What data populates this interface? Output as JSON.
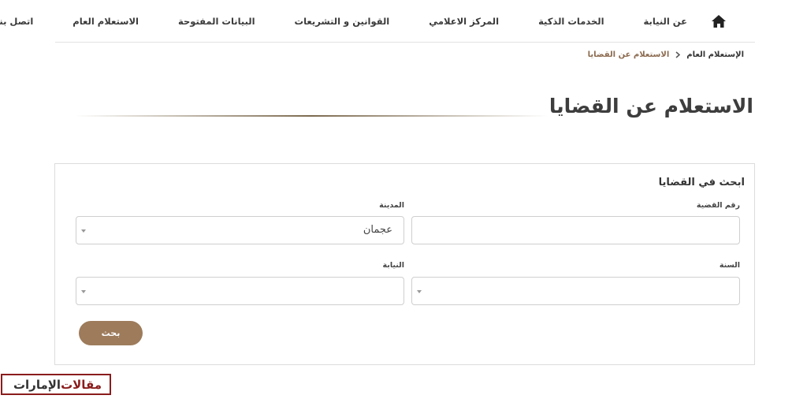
{
  "nav": {
    "home_icon": "home-icon",
    "items": [
      "عن النيابة",
      "الخدمات الذكية",
      "المركز الاعلامي",
      "القوانين و التشريعات",
      "البيانات المفتوحة",
      "الاستعلام العام",
      "اتصل بنا"
    ]
  },
  "breadcrumb": {
    "parent": "الإستعلام العام",
    "separator_icon": "chevron-right-icon",
    "current": "الاستعلام عن القضايا"
  },
  "page_title": "الاستعلام عن القضايا",
  "search": {
    "title": "ابحث في القضايا",
    "case_number": {
      "label": "رقم القضية",
      "value": ""
    },
    "city": {
      "label": "المدينة",
      "selected": "عجمان"
    },
    "year": {
      "label": "السنة",
      "selected": ""
    },
    "prosecution": {
      "label": "النيابة",
      "selected": ""
    },
    "button_label": "بحث"
  },
  "watermark": {
    "word1": "مقالات",
    "word2": "الإمارات"
  },
  "colors": {
    "accent": "#9d7b5b",
    "breadcrumb_current": "#8b6a4f",
    "watermark": "#8a1c1c"
  }
}
